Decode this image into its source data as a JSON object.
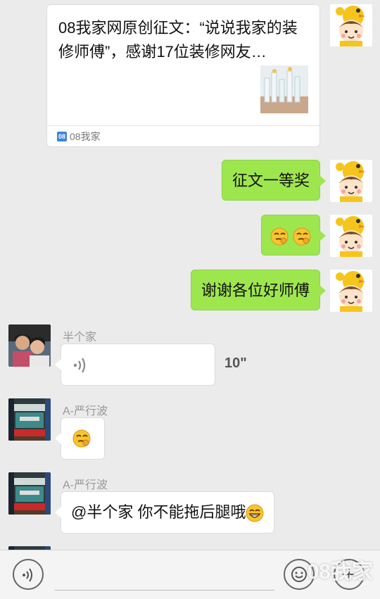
{
  "card": {
    "title": "08我家网原创征文：“说说我家的装修师傅”，感谢17位装修网友…",
    "source_label": "08我家",
    "source_icon_text": "08"
  },
  "messages": {
    "m1": "征文一等奖",
    "m3": "谢谢各位好师傅",
    "voice_sender": "半个家",
    "voice_duration": "10\"",
    "sender_a": "A-严行波",
    "sender_b": "A-严行波",
    "last_text": "@半个家 你不能拖后腿哦"
  },
  "icons": {
    "grin": "grin-emoji",
    "smirk": "smirk-emoji",
    "voice": "voice-icon"
  },
  "watermark": "08我家",
  "colors": {
    "green_bubble": "#9ee64e",
    "background": "#ebebeb",
    "sender_name": "#9a9a9a"
  }
}
